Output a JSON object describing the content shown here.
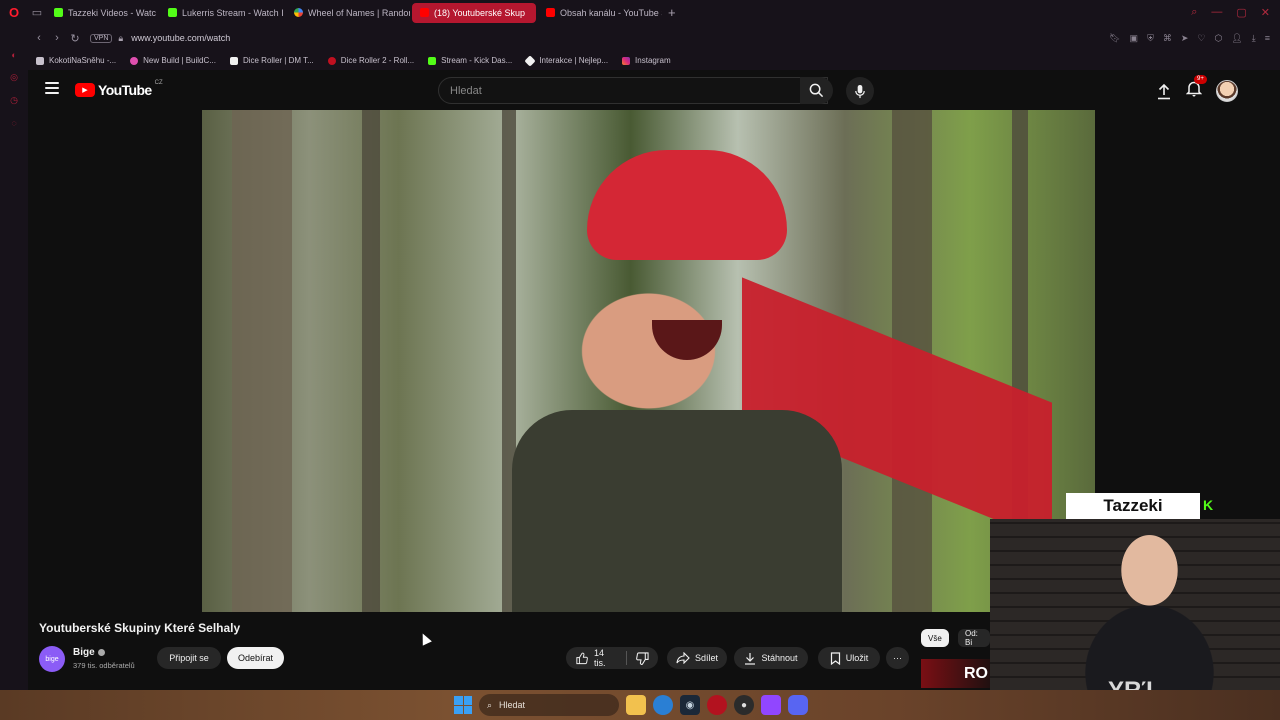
{
  "browser": {
    "tabs": [
      {
        "label": "Tazzeki Videos - Watc",
        "favicon_color": "#53fc18"
      },
      {
        "label": "Lukerris Stream - Watch I",
        "favicon_color": "#53fc18"
      },
      {
        "label": "Wheel of Names | Random",
        "favicon_color": "#4285f4"
      },
      {
        "label": "(18) Youtuberské Skup",
        "favicon_color": "#ff0000",
        "active": true
      },
      {
        "label": "Obsah kanálu - YouTube S",
        "favicon_color": "#ff0000"
      }
    ],
    "new_tab": "+",
    "url": "www.youtube.com/watch",
    "vpn_label": "VPN",
    "bookmarks": [
      {
        "label": "KokotiNaSněhu -...",
        "color": "#c7c0cc"
      },
      {
        "label": "New Build | BuildC...",
        "color": "#e04fb0"
      },
      {
        "label": "Dice Roller | DM T...",
        "color": "#f1f1f1"
      },
      {
        "label": "Dice Roller 2 - Roll...",
        "color": "#c01020"
      },
      {
        "label": "Stream - Kick Das...",
        "color": "#53fc18"
      },
      {
        "label": "Interakce | Nejlep...",
        "color": "#f1f1f1"
      },
      {
        "label": "Instagram",
        "color": "#e1306c"
      }
    ]
  },
  "youtube": {
    "logo_text": "YouTube",
    "country_code": "CZ",
    "search_placeholder": "Hledat",
    "notification_badge": "9+"
  },
  "webcam": {
    "name": "Tazzeki",
    "shirt_text": "ΥRΊ"
  },
  "video": {
    "title": "Youtuberské Skupiny Které Selhaly",
    "channel_name": "Bige",
    "channel_avatar_text": "bige",
    "subscribers": "379 tis. odběratelů",
    "join_label": "Připojit se",
    "subscribe_label": "Odebírat",
    "likes": "14 tis.",
    "share_label": "Sdílet",
    "download_label": "Stáhnout",
    "save_label": "Uložit",
    "more_label": "···"
  },
  "chips": {
    "all": "Vše",
    "from": "Od: Bi"
  },
  "ad": {
    "text": "RO"
  },
  "taskbar": {
    "search_placeholder": "Hledat"
  },
  "colors": {
    "accent": "#ff0000",
    "opera": "#ff1b2d",
    "kick": "#53fc18"
  }
}
